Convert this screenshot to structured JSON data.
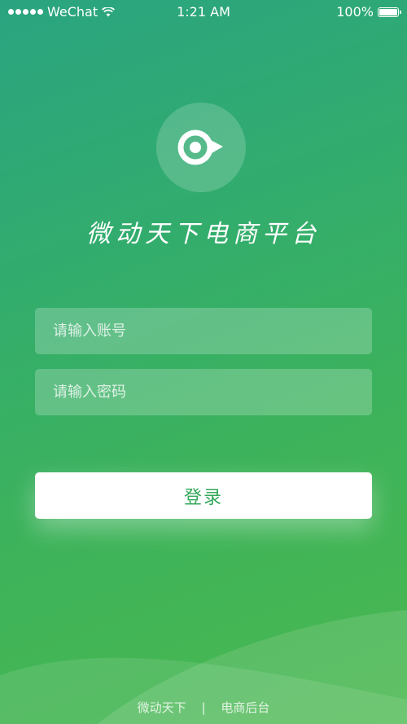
{
  "status_bar": {
    "carrier": "WeChat",
    "time": "1:21 AM",
    "battery": "100%",
    "battery_level": 1.0
  },
  "app": {
    "title": "微动天下电商平台"
  },
  "form": {
    "account_placeholder": "请输入账号",
    "password_placeholder": "请输入密码",
    "login_label": "登录"
  },
  "footer": {
    "left": "微动天下",
    "separator": "|",
    "right": "电商后台"
  },
  "colors": {
    "gradient_top": "#2aa480",
    "gradient_bottom": "#4ab84e",
    "button_text": "#33a85a"
  }
}
